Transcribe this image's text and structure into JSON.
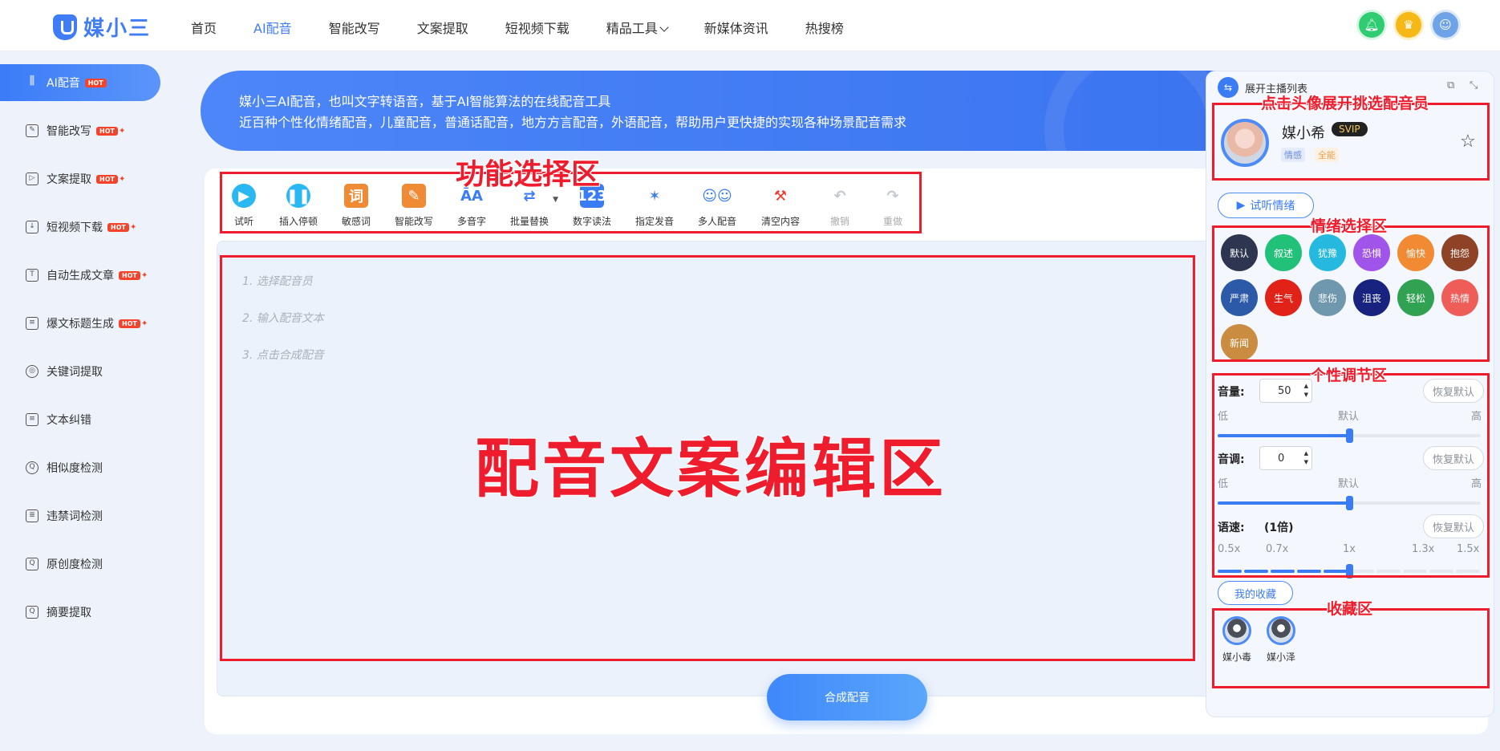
{
  "header": {
    "logo_text": "媒小三",
    "nav": [
      {
        "label": "首页"
      },
      {
        "label": "AI配音"
      },
      {
        "label": "智能改写"
      },
      {
        "label": "文案提取"
      },
      {
        "label": "短视频下载"
      },
      {
        "label": "精品工具"
      },
      {
        "label": "新媒体资讯"
      },
      {
        "label": "热搜榜"
      }
    ],
    "active_nav": "AI配音",
    "icons": [
      "bell-icon",
      "crown-icon",
      "user-avatar"
    ]
  },
  "sidebar": {
    "items": [
      {
        "label": "AI配音",
        "hot": "HOT",
        "icon": "waveform-icon"
      },
      {
        "label": "智能改写",
        "hot": "HOT",
        "icon": "edit-icon"
      },
      {
        "label": "文案提取",
        "hot": "HOT",
        "icon": "video-icon"
      },
      {
        "label": "短视频下载",
        "hot": "HOT",
        "icon": "cloud-download-icon"
      },
      {
        "label": "自动生成文章",
        "hot": "HOT",
        "icon": "text-icon"
      },
      {
        "label": "爆文标题生成",
        "hot": "HOT",
        "icon": "title-icon"
      },
      {
        "label": "关键词提取",
        "icon": "target-icon"
      },
      {
        "label": "文本纠错",
        "icon": "bug-icon"
      },
      {
        "label": "相似度检测",
        "icon": "search-icon"
      },
      {
        "label": "违禁词检测",
        "icon": "forbidden-icon"
      },
      {
        "label": "原创度检测",
        "icon": "doc-search-icon"
      },
      {
        "label": "摘要提取",
        "icon": "doc-search-icon"
      }
    ]
  },
  "banner": {
    "line1": "媒小三AI配音，也叫文字转语音，基于AI智能算法的在线配音工具",
    "line2": "近百种个性化情绪配音，儿童配音，普通话配音，地方方言配音，外语配音，帮助用户更快捷的实现各种场景配音需求"
  },
  "toolbar": {
    "tools": [
      {
        "label": "试听",
        "icon": "play-icon"
      },
      {
        "label": "插入停顿",
        "icon": "pause-icon"
      },
      {
        "label": "敏感词",
        "icon": "sensitive-word-icon"
      },
      {
        "label": "智能改写",
        "icon": "pen-icon"
      },
      {
        "label": "多音字",
        "icon": "polyphone-icon"
      },
      {
        "label": "批量替换",
        "icon": "replace-icon"
      },
      {
        "label": "数字读法",
        "icon": "number-icon"
      },
      {
        "label": "指定发音",
        "icon": "pronounce-icon"
      },
      {
        "label": "多人配音",
        "icon": "users-icon"
      },
      {
        "label": "清空内容",
        "icon": "broom-icon"
      },
      {
        "label": "撤销",
        "icon": "undo-icon"
      },
      {
        "label": "重做",
        "icon": "redo-icon"
      }
    ]
  },
  "editor": {
    "steps": [
      "1. 选择配音员",
      "2. 输入配音文本",
      "3. 点击合成配音"
    ],
    "big_label": "配音文案编辑区"
  },
  "annotations": {
    "function_area": "功能选择区",
    "speaker_hint": "点击头像展开挑选配音员",
    "emotion_area": "情绪选择区",
    "adjust_area": "个性调节区",
    "favorite_area": "收藏区"
  },
  "synth_button": "合成配音",
  "right_panel": {
    "expand_label": "展开主播列表",
    "speaker": {
      "name": "媒小希",
      "badge": "SVIP",
      "tags": [
        "情感",
        "全能"
      ]
    },
    "trial_emotion": "试听情绪",
    "emotions": [
      {
        "label": "默认",
        "color": "#2d3550"
      },
      {
        "label": "叙述",
        "color": "#22c17a"
      },
      {
        "label": "犹豫",
        "color": "#25b9e0"
      },
      {
        "label": "恐惧",
        "color": "#a154ea"
      },
      {
        "label": "愉快",
        "color": "#f28a33"
      },
      {
        "label": "抱怨",
        "color": "#8e4226"
      },
      {
        "label": "严肃",
        "color": "#2d5aa8"
      },
      {
        "label": "生气",
        "color": "#e02218"
      },
      {
        "label": "悲伤",
        "color": "#6f97ad"
      },
      {
        "label": "沮丧",
        "color": "#17237e"
      },
      {
        "label": "轻松",
        "color": "#31a152"
      },
      {
        "label": "热情",
        "color": "#ee5d58"
      },
      {
        "label": "新闻",
        "color": "#c98c40"
      }
    ],
    "volume": {
      "label": "音量:",
      "value": "50",
      "low": "低",
      "mid": "默认",
      "high": "高",
      "reset": "恢复默认",
      "level": 0.5
    },
    "pitch": {
      "label": "音调:",
      "value": "0",
      "low": "低",
      "mid": "默认",
      "high": "高",
      "reset": "恢复默认",
      "level": 0.5
    },
    "speed": {
      "label": "语速:",
      "value": "(1倍)",
      "reset": "恢复默认",
      "ticks": [
        "0.5x",
        "0.7x",
        "1x",
        "1.3x",
        "1.5x"
      ],
      "level": 0.5
    },
    "favorites_btn": "我的收藏",
    "favorites": [
      {
        "name": "媒小毒"
      },
      {
        "name": "媒小泽"
      }
    ]
  }
}
